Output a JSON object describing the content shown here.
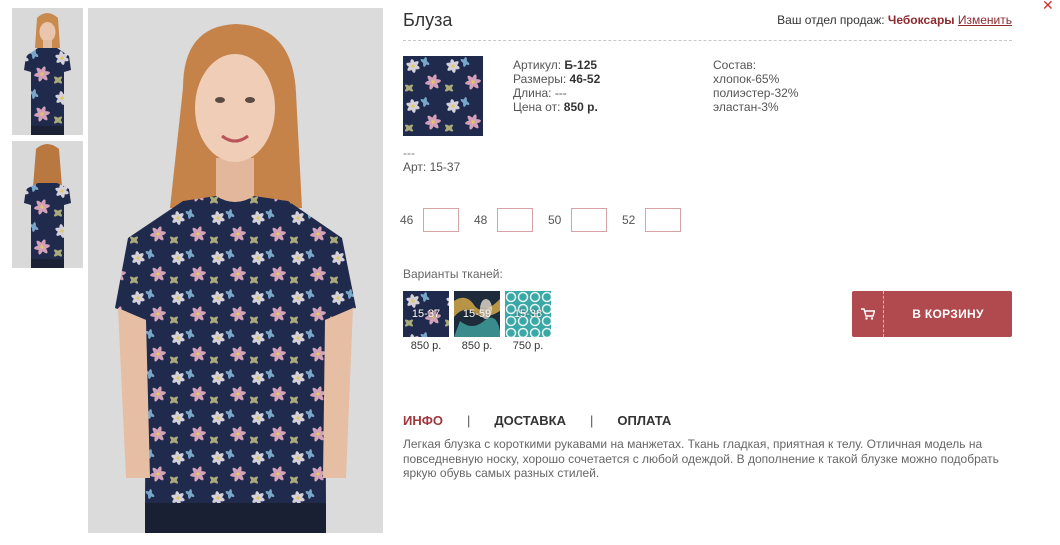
{
  "product": {
    "title": "Блуза"
  },
  "sales": {
    "label": "Ваш отдел продаж:",
    "city": "Чебоксары",
    "change_link": "Изменить"
  },
  "specs": {
    "article_label": "Артикул:",
    "article_value": "Б-125",
    "sizes_label": "Размеры:",
    "sizes_value": "46-52",
    "length_label": "Длина:",
    "length_value": "---",
    "price_label": "Цена от:",
    "price_value": "850 р."
  },
  "composition": {
    "title": "Состав:",
    "items": [
      "хлопок-65%",
      "полиэстер-32%",
      "эластан-3%"
    ]
  },
  "fabric_note": {
    "dash": "---",
    "art": "Арт: 15-37"
  },
  "sizes": [
    "46",
    "48",
    "50",
    "52"
  ],
  "variants": {
    "title": "Варианты тканей:",
    "items": [
      {
        "code": "15-37",
        "price": "850 р."
      },
      {
        "code": "15-59",
        "price": "850 р."
      },
      {
        "code": "15-38",
        "price": "750 р."
      }
    ]
  },
  "cart": {
    "label": "В КОРЗИНУ",
    "icon": "cart-icon"
  },
  "tabs": [
    "ИНФО",
    "ДОСТАВКА",
    "ОПЛАТА"
  ],
  "description": "Легкая блузка с короткими рукавами на манжетах. Ткань гладкая, приятная к телу. Отличная модель на повседневную носку, хорошо сочетается с любой одеждой. В дополнение к такой блузке можно подобрать яркую обувь самых разных стилей.",
  "colors": {
    "accent": "#b04a4e",
    "link": "#8b2a2f",
    "fabric_base": "#1f2a4d"
  }
}
